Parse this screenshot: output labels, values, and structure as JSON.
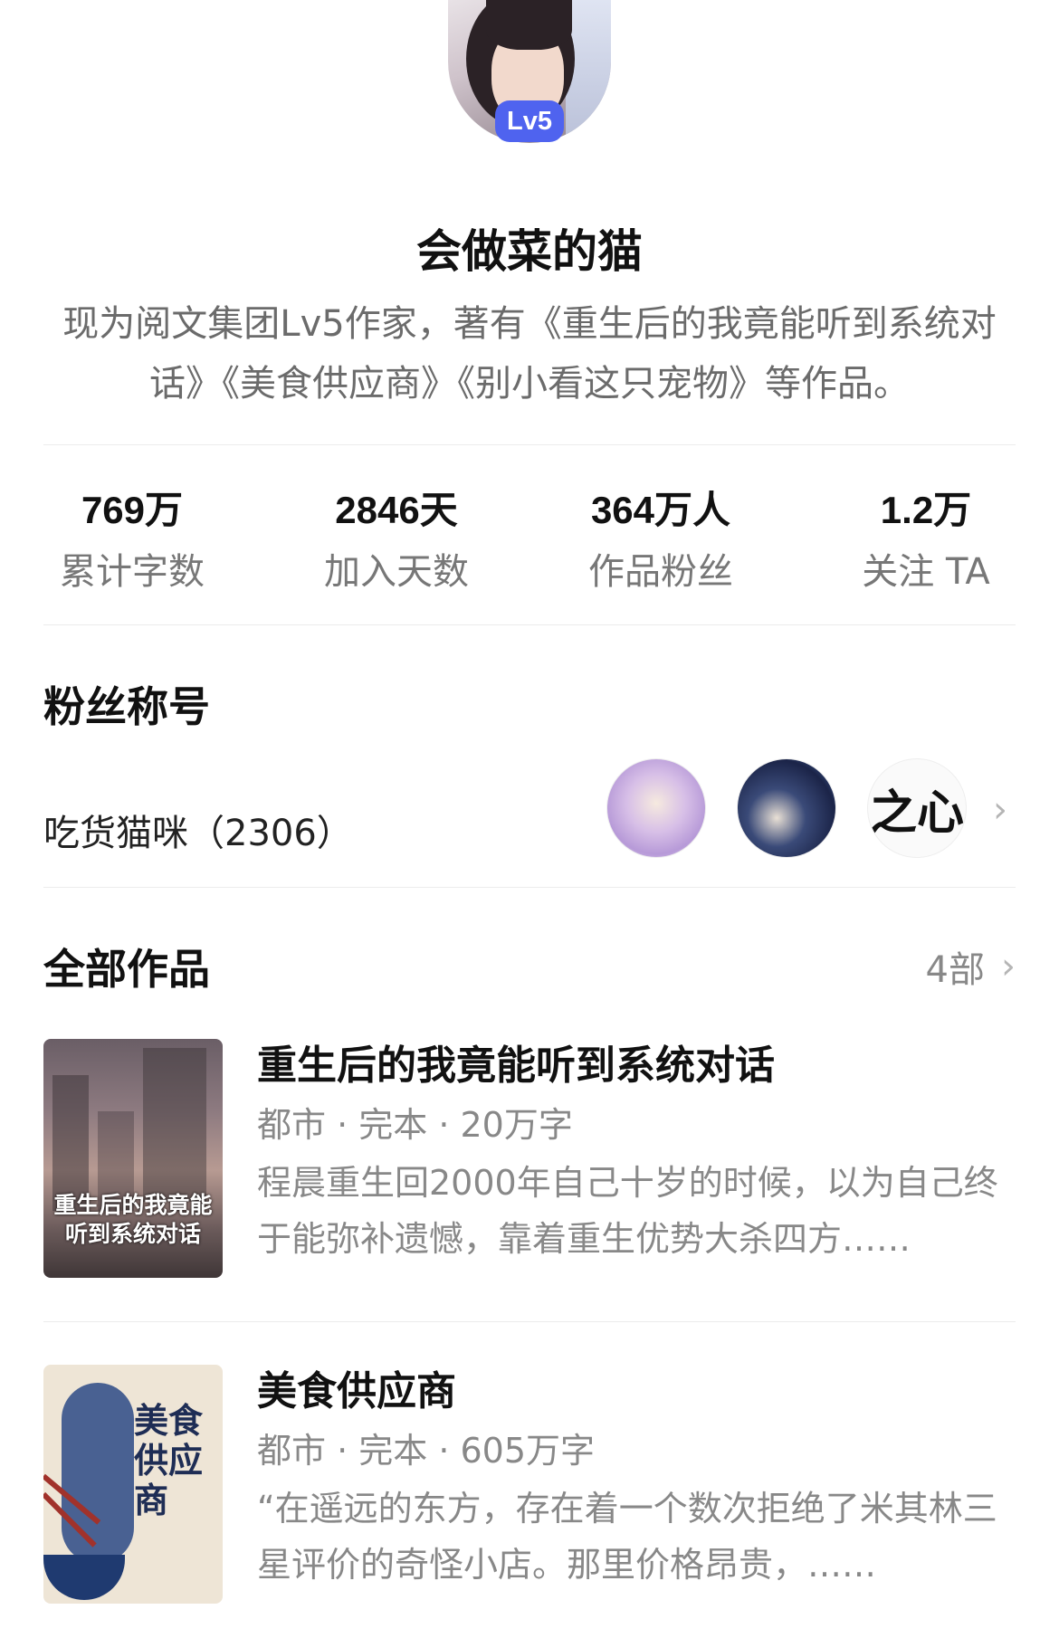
{
  "profile": {
    "level_badge": "Lv5",
    "name": "会做菜的猫",
    "bio": "现为阅文集团Lv5作家，著有《重生后的我竟能听到系统对话》《美食供应商》《别小看这只宠物》等作品。"
  },
  "stats": [
    {
      "value": "769万",
      "label": "累计字数"
    },
    {
      "value": "2846天",
      "label": "加入天数"
    },
    {
      "value": "364万人",
      "label": "作品粉丝"
    },
    {
      "value": "1.2万",
      "label": "关注 TA"
    }
  ],
  "fan_section": {
    "title": "粉丝称号",
    "fan_title": "吃货猫咪（2306）",
    "avatar3_text": "之心"
  },
  "works": {
    "title": "全部作品",
    "count": "4部",
    "items": [
      {
        "title": "重生后的我竟能听到系统对话",
        "meta": "都市 · 完本 · 20万字",
        "desc": "程晨重生回2000年自己十岁的时候，以为自己终于能弥补遗憾，靠着重生优势大杀四方……",
        "cover_text": "重生后的我竟能听到系统对话"
      },
      {
        "title": "美食供应商",
        "meta": "都市 · 完本 · 605万字",
        "desc": "“在遥远的东方，存在着一个数次拒绝了米其林三星评价的奇怪小店。那里价格昂贵，……",
        "cover_text": "美食供应商"
      }
    ]
  }
}
